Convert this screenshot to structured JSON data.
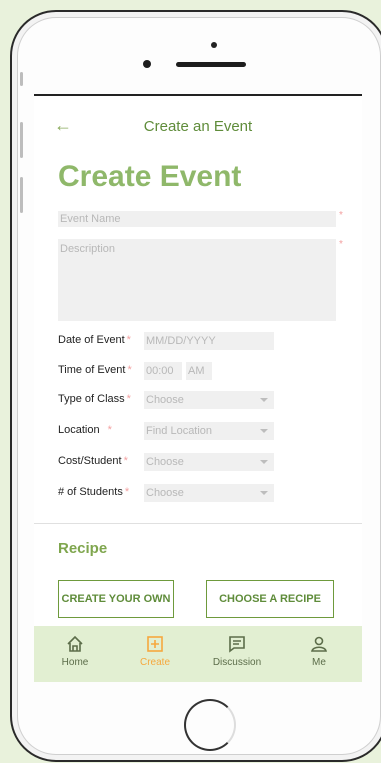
{
  "header": {
    "title": "Create an Event",
    "back_icon": "arrow-left-icon"
  },
  "page_title": "Create Event",
  "form": {
    "event_name_placeholder": "Event Name",
    "description_placeholder": "Description",
    "date": {
      "label": "Date of Event",
      "placeholder": "MM/DD/YYYY"
    },
    "time": {
      "label": "Time of Event",
      "time_value": "00:00",
      "ampm_value": "AM"
    },
    "class_type": {
      "label": "Type of Class",
      "value": "Choose"
    },
    "location": {
      "label": "Location",
      "value": "Find Location"
    },
    "cost": {
      "label": "Cost/Student",
      "value": "Choose"
    },
    "students": {
      "label": "# of Students",
      "value": "Choose"
    },
    "required_mark": "*"
  },
  "recipe": {
    "heading": "Recipe",
    "create_own": "CREATE YOUR OWN",
    "choose_recipe": "CHOOSE A RECIPE"
  },
  "tabs": [
    {
      "label": "Home",
      "icon": "home-icon",
      "active": false
    },
    {
      "label": "Create",
      "icon": "plus-square-icon",
      "active": true
    },
    {
      "label": "Discussion",
      "icon": "chat-icon",
      "active": false
    },
    {
      "label": "Me",
      "icon": "user-icon",
      "active": false
    }
  ],
  "colors": {
    "accent": "#8fb86a",
    "active_tab": "#f6a83e",
    "tabbar_bg": "#e2efd2",
    "page_bg": "#e9f2dc"
  }
}
